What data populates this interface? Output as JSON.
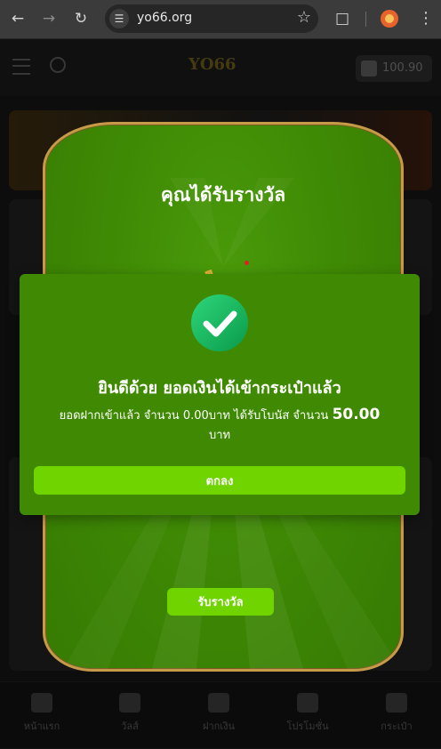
{
  "browser": {
    "url": "yo66.org",
    "icons": [
      "back-arrow-icon",
      "forward-arrow-icon",
      "reload-icon",
      "site-settings-icon",
      "bookmark-star-icon",
      "extensions-icon",
      "profile-avatar-icon",
      "kebab-menu-icon"
    ]
  },
  "site": {
    "balance": "100.90",
    "nav": [
      "หน้าแรก",
      "วัลส์",
      "ฝากเงิน",
      "โปรโมชั่น",
      "กระเป๋า"
    ]
  },
  "reward_popup": {
    "title": "คุณได้รับรางวัล",
    "receive_label": "รับรางวัล"
  },
  "success_dialog": {
    "title": "ยินดีด้วย ยอดเงินได้เข้ากระเป๋าแล้ว",
    "detail_prefix": "ยอดฝากเข้าแล้ว จำนวน 0.00บาท ได้รับโบนัส จำนวน",
    "bonus_amount": "50.00",
    "currency": "บาท",
    "ok_label": "ตกลง"
  },
  "colors": {
    "card_green": "#3f8a05",
    "button_green": "#6fd400",
    "border_gold": "#c79a4a",
    "check_green": "#0a9a4a"
  }
}
